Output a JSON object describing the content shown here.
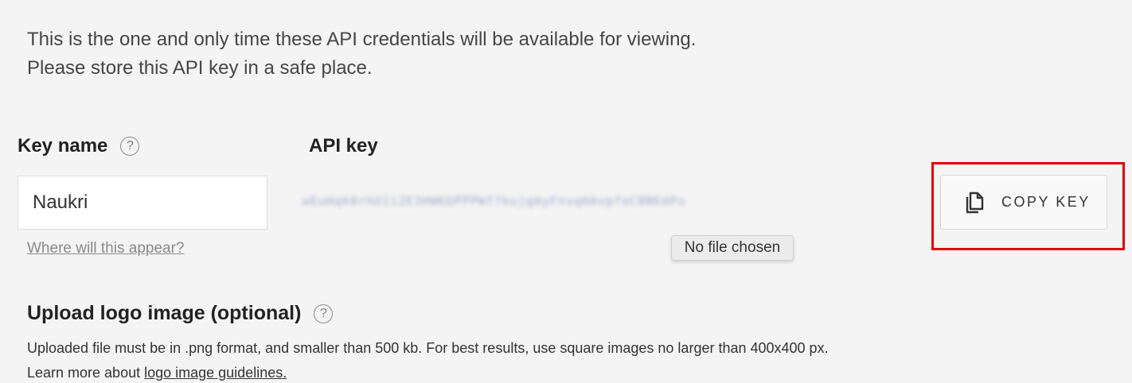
{
  "intro": {
    "line1": "This is the one and only time these API credentials will be available for viewing.",
    "line2": "Please store this API key in a safe place."
  },
  "key_name": {
    "label": "Key name",
    "help_icon": "question-circle-icon",
    "help_glyph": "?",
    "value": "Naukri",
    "help_link": "Where will this appear?"
  },
  "api_key": {
    "label": "API key",
    "value_redacted": "wEuHqk8rhU1iZE3HWKQPPPWf7kujgAyFnxqHAvpfeC8NEdPu"
  },
  "file_input": {
    "status": "No file chosen"
  },
  "copy_button": {
    "icon": "copy-icon",
    "label": "COPY KEY"
  },
  "upload": {
    "title": "Upload logo image (optional)",
    "help_glyph": "?",
    "description": "Uploaded file must be in .png format, and smaller than 500 kb. For best results, use square images no larger than 400x400 px.",
    "learn_more_prefix": "Learn more about ",
    "guidelines_link": "logo image guidelines."
  },
  "colors": {
    "background": "#f4f4f4",
    "highlight": "#e0000a"
  }
}
